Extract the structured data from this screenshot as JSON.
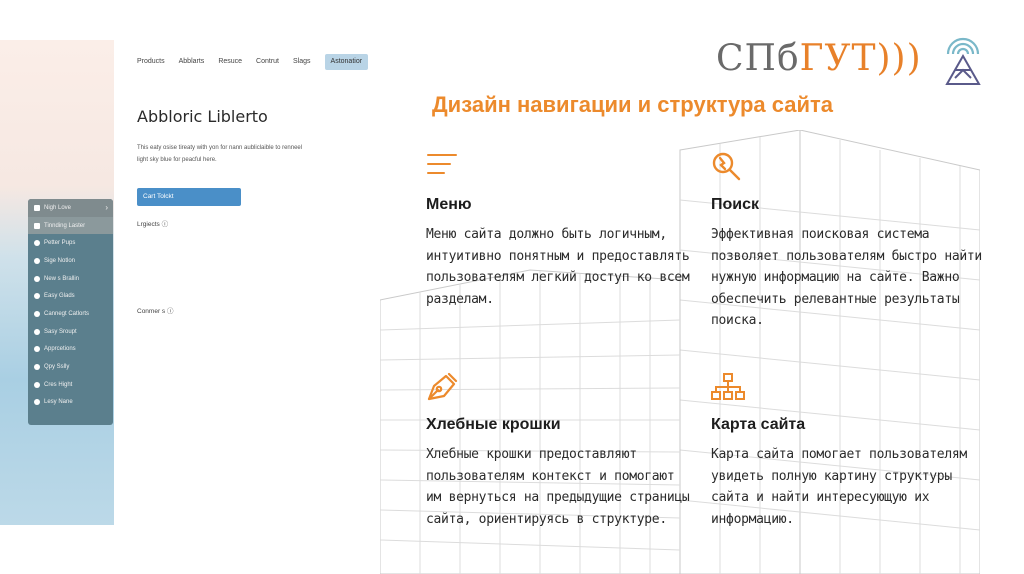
{
  "mockup": {
    "nav": [
      "Products",
      "Abblarts",
      "Resuce",
      "Contrut",
      "Slags",
      "Astonatior"
    ],
    "title": "Abbloric Liblerto",
    "desc": "This eaty osise tireaty with yon for nann aubliclaible to renneel light sky blue for peacful here.",
    "button": "Cart Tolckt",
    "label1": "Lrgiects ⓘ",
    "label2": "Conmer s ⓘ",
    "menu": [
      "Nigh Love",
      "Tinnding Laster",
      "Petter Pups",
      "Sige Notlon",
      "New s Brallin",
      "Easy Glads",
      "Cannegt Catlorts",
      "Sasy Sroupt",
      "Apprcetions",
      "Qpy Sslly",
      "Cres Hight",
      "Lesy Nane"
    ]
  },
  "logo": {
    "part1": "СПб",
    "part2": "ГУТ",
    "waves": ")))"
  },
  "title": "Дизайн навигации и структура сайта",
  "cards": [
    {
      "icon": "menu-icon",
      "heading": "Меню",
      "text": "Меню сайта должно быть логичным, интуитивно понятным и предоставлять пользователям легкий доступ ко всем разделам."
    },
    {
      "icon": "search-icon",
      "heading": "Поиск",
      "text": "Эффективная поисковая система позволяет пользователям быстро найти нужную информацию на сайте. Важно обеспечить релевантные результаты поиска."
    },
    {
      "icon": "pen-icon",
      "heading": "Хлебные крошки",
      "text": "Хлебные крошки предоставляют пользователям контекст и помогают им вернуться на предыдущие страницы сайта, ориентируясь в структуре."
    },
    {
      "icon": "sitemap-icon",
      "heading": "Карта сайта",
      "text": "Карта сайта помогает пользователям увидеть полную картину структуры сайта и найти интересующую их информацию."
    }
  ],
  "colors": {
    "accent": "#ec8a2c",
    "text": "#2b2b2b",
    "logo_gray": "#6a6a6a"
  }
}
